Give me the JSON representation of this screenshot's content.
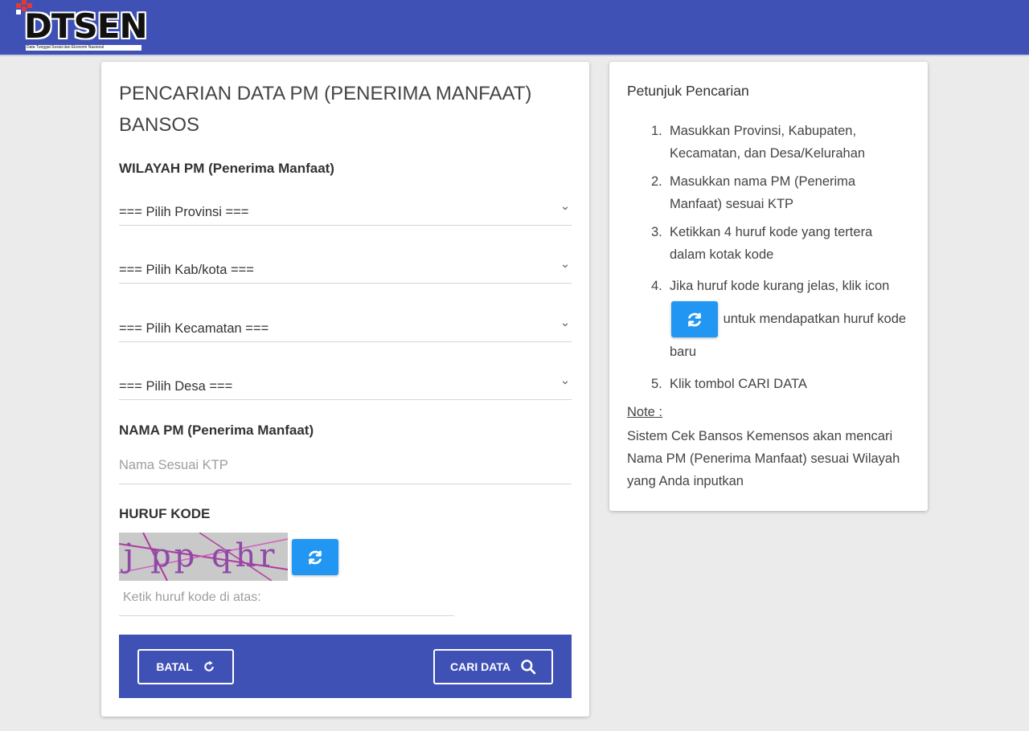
{
  "header": {
    "logo_text": "DTSEN",
    "logo_tagline": "Data Tunggal Sosial dan Ekonomi Nasional",
    "background": "#3f51b5"
  },
  "search_form": {
    "title": "PENCARIAN DATA PM (PENERIMA MANFAAT) BANSOS",
    "wilayah_label": "WILAYAH PM (Penerima Manfaat)",
    "provinsi_selected": "=== Pilih Provinsi ===",
    "kabkota_selected": "=== Pilih Kab/kota ===",
    "kecamatan_selected": "=== Pilih Kecamatan ===",
    "desa_selected": "=== Pilih Desa ===",
    "nama_label": "NAMA PM (Penerima Manfaat)",
    "nama_placeholder": "Nama Sesuai KTP",
    "nama_value": "",
    "kode_label": "HURUF KODE",
    "captcha_text": "j pp qhr",
    "kode_placeholder": "Ketik huruf kode di atas:",
    "kode_value": "",
    "batal_label": "BATAL",
    "cari_label": "CARI DATA"
  },
  "instructions": {
    "title": "Petunjuk Pencarian",
    "step1": "Masukkan Provinsi, Kabupaten, Kecamatan, dan Desa/Kelurahan",
    "step2": "Masukkan nama PM (Penerima Manfaat) sesuai KTP",
    "step3": "Ketikkan 4 huruf kode yang tertera dalam kotak kode",
    "step4_before": "Jika huruf kode kurang jelas, klik icon",
    "step4_after": "untuk mendapatkan huruf kode baru",
    "step5": "Klik tombol CARI DATA",
    "note_heading": "Note :",
    "note_text": "Sistem Cek Bansos Kemensos akan mencari Nama PM (Penerima Manfaat) sesuai Wilayah yang Anda inputkan"
  },
  "colors": {
    "primary": "#3f51b5",
    "accent": "#2196f3",
    "background": "#ebebeb"
  },
  "icons": {
    "refresh": "refresh-icon",
    "search": "search-icon",
    "undo": "undo-icon",
    "chevron": "chevron-down-icon"
  }
}
